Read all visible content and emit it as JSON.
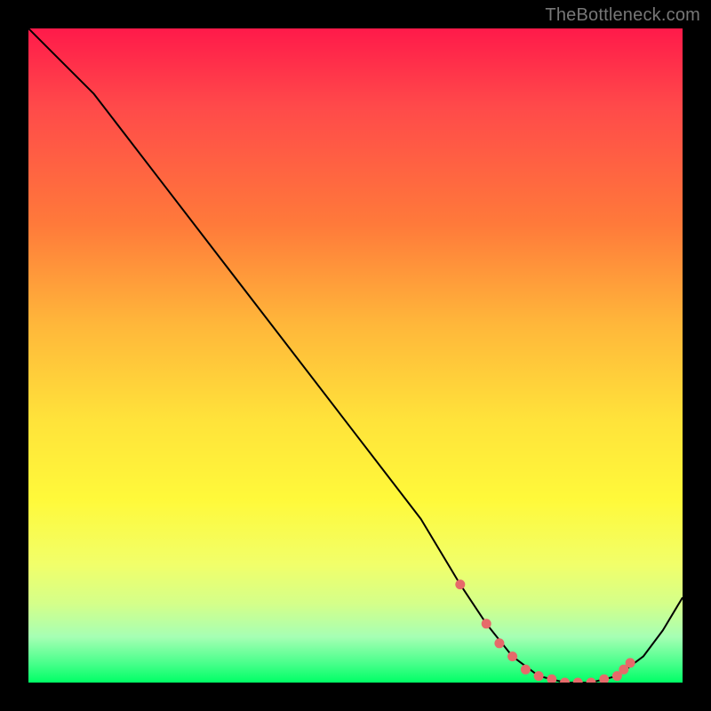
{
  "watermark": "TheBottleneck.com",
  "colors": {
    "curve": "#000000",
    "markers": "#e66a6a",
    "background_black": "#000000"
  },
  "chart_data": {
    "type": "line",
    "title": "",
    "xlabel": "",
    "ylabel": "",
    "xlim": [
      0,
      100
    ],
    "ylim": [
      0,
      100
    ],
    "grid": false,
    "legend": false,
    "series": [
      {
        "name": "bottleneck-curve",
        "x": [
          0,
          4,
          10,
          20,
          30,
          40,
          50,
          60,
          66,
          70,
          74,
          78,
          82,
          86,
          90,
          94,
          97,
          100
        ],
        "y": [
          100,
          96,
          90,
          77,
          64,
          51,
          38,
          25,
          15,
          9,
          4,
          1,
          0,
          0,
          1,
          4,
          8,
          13
        ]
      }
    ],
    "markers": {
      "name": "highlight-dots",
      "x": [
        66,
        70,
        72,
        74,
        76,
        78,
        80,
        82,
        84,
        86,
        88,
        90,
        91,
        92
      ],
      "y": [
        15,
        9,
        6,
        4,
        2,
        1,
        0.5,
        0,
        0,
        0,
        0.5,
        1,
        2,
        3
      ]
    }
  }
}
